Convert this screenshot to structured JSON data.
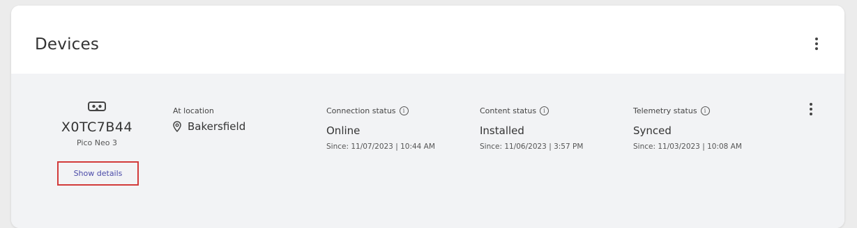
{
  "card": {
    "title": "Devices",
    "menu_icon": "more-vertical-icon"
  },
  "device": {
    "icon": "vr-headset-icon",
    "id": "X0TC7B44",
    "model": "Pico Neo 3",
    "details_button": "Show details",
    "menu_icon": "more-vertical-icon",
    "location": {
      "label": "At location",
      "icon": "map-pin-icon",
      "value": "Bakersfield"
    },
    "connection": {
      "label": "Connection status",
      "value": "Online",
      "since": "Since: 11/07/2023 | 10:44 AM"
    },
    "content": {
      "label": "Content status",
      "value": "Installed",
      "since": "Since: 11/06/2023 | 3:57 PM"
    },
    "telemetry": {
      "label": "Telemetry status",
      "value": "Synced",
      "since": "Since: 11/03/2023 | 10:08 AM"
    }
  },
  "colors": {
    "highlight_border": "#d23a3a",
    "link": "#4a4aa8",
    "row_background": "#f2f3f5"
  }
}
